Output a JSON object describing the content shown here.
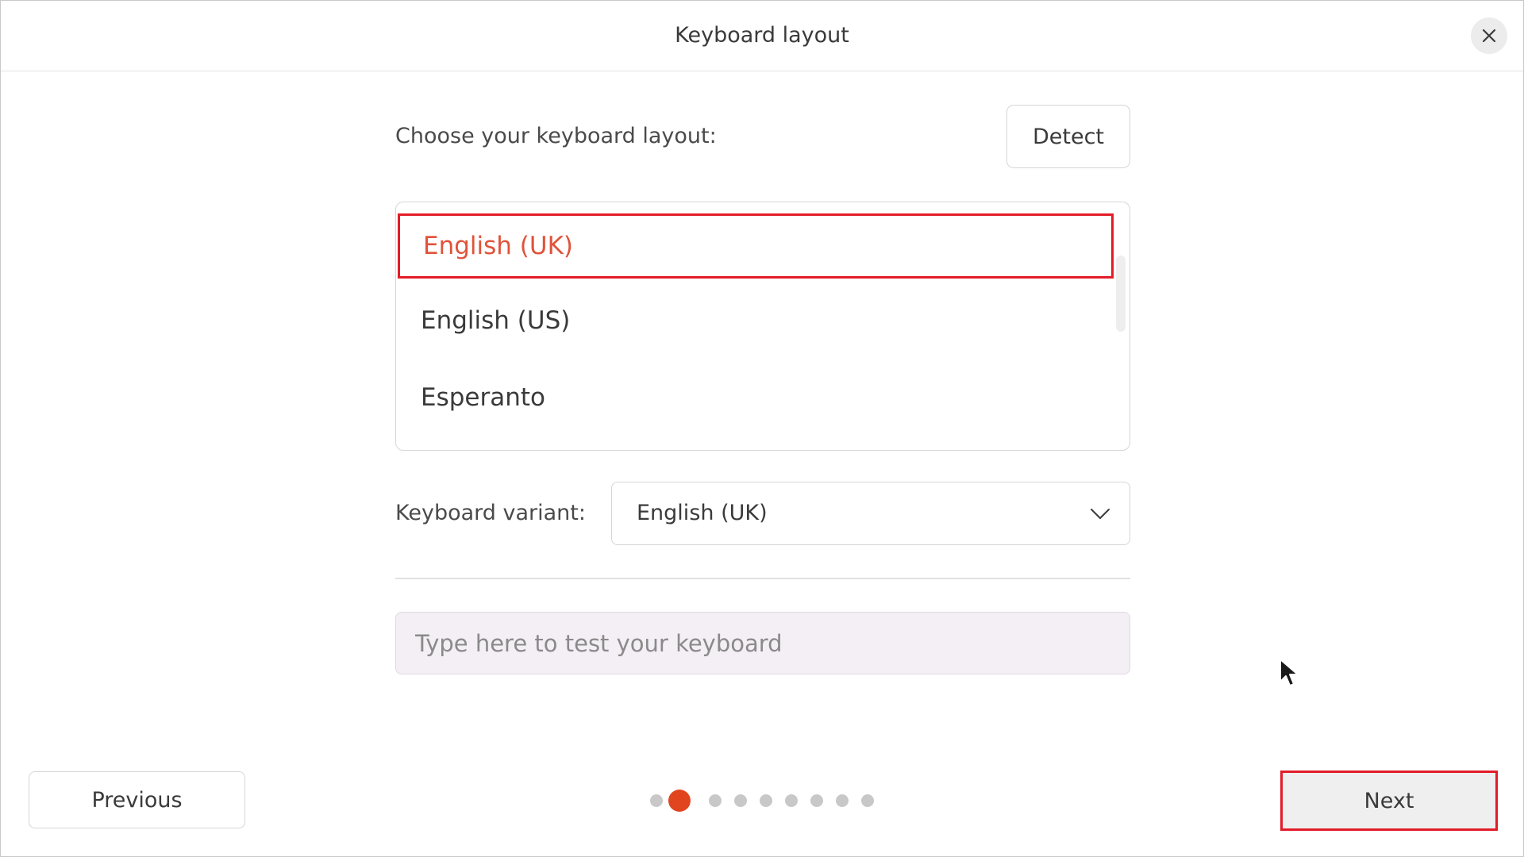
{
  "window": {
    "title": "Keyboard layout",
    "close_icon": "close-icon"
  },
  "layout": {
    "prompt": "Choose your keyboard layout:",
    "detect_label": "Detect",
    "items": [
      {
        "label": "English (UK)",
        "selected": true
      },
      {
        "label": "English (US)",
        "selected": false
      },
      {
        "label": "Esperanto",
        "selected": false
      }
    ]
  },
  "variant": {
    "label": "Keyboard variant:",
    "value": "English (UK)",
    "dropdown_icon": "chevron-down-icon"
  },
  "test": {
    "placeholder": "Type here to test your keyboard"
  },
  "nav": {
    "previous_label": "Previous",
    "next_label": "Next",
    "total_steps": 9,
    "current_step": 2
  },
  "colors": {
    "accent": "#e0451f",
    "highlight_border": "#e21c28",
    "dot_inactive": "#c8c8c8"
  }
}
